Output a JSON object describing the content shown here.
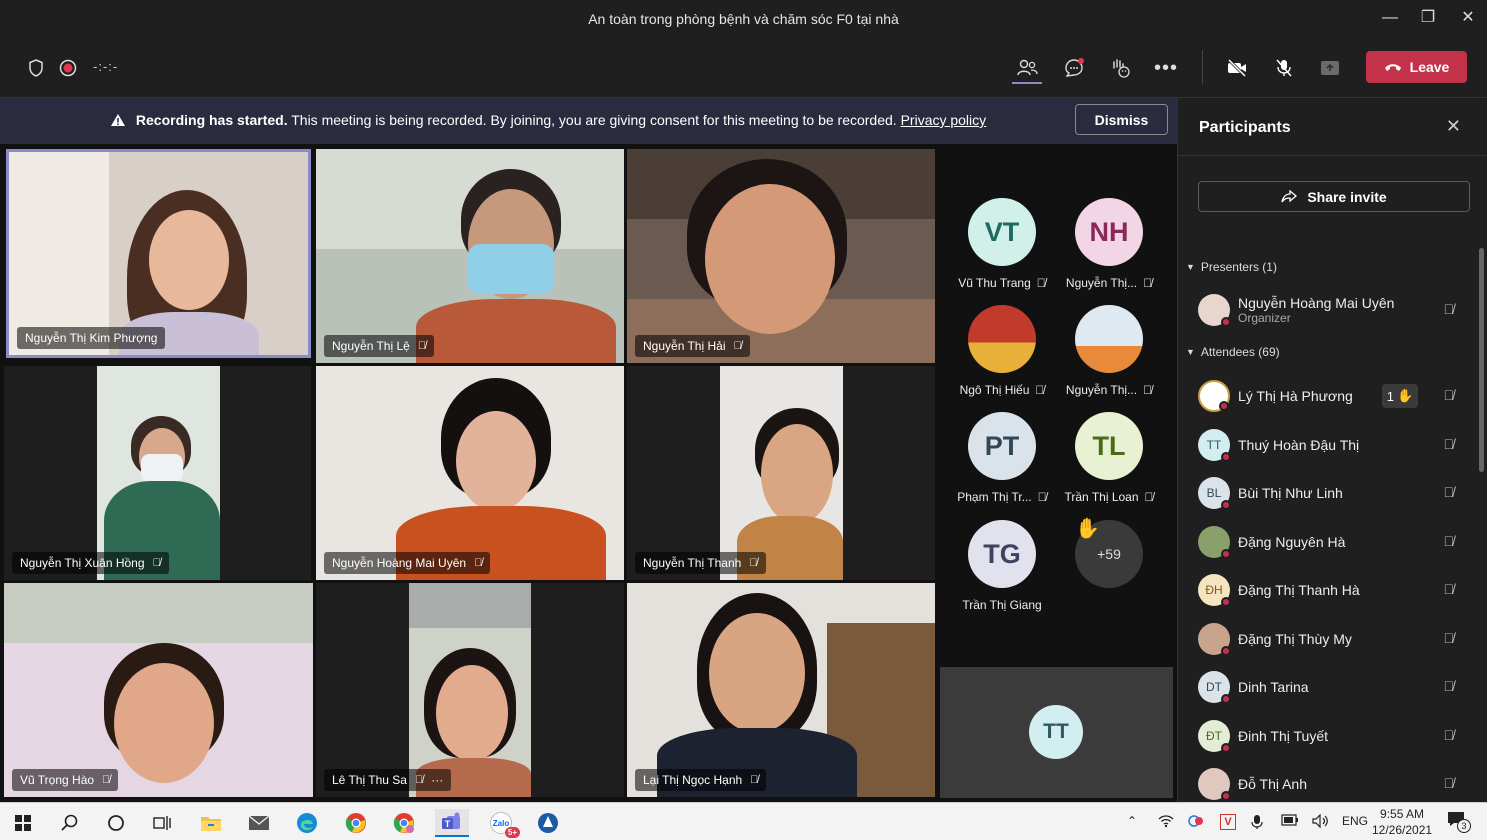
{
  "window": {
    "title": "An toàn trong phòng bệnh và chăm sóc F0 tại nhà",
    "controls": [
      "—",
      "❐",
      "✕"
    ]
  },
  "toolbar": {
    "timer": "-:-:-",
    "leave_label": "Leave",
    "icons": [
      "shield-icon",
      "record-icon",
      "people-icon",
      "chat-icon",
      "reactions-icon",
      "more-icon",
      "camera-off-icon",
      "mic-off-icon",
      "share-tray-icon"
    ]
  },
  "banner": {
    "bold": "Recording has started.",
    "text": " This meeting is being recorded. By joining, you are giving consent for this meeting to be recorded. ",
    "link": "Privacy policy",
    "dismiss_label": "Dismiss"
  },
  "video_tiles": [
    {
      "name": "Nguyễn Thị Kim Phượng",
      "muted": false
    },
    {
      "name": "Nguyễn Thị Lệ",
      "muted": true
    },
    {
      "name": "Nguyễn Thị Hải",
      "muted": true
    },
    {
      "name": "Nguyễn Thị Xuân Hồng",
      "muted": true
    },
    {
      "name": "Nguyễn Hoàng Mai Uyên",
      "muted": true
    },
    {
      "name": "Nguyễn Thị Thanh",
      "muted": true
    },
    {
      "name": "Vũ Trọng Hào",
      "muted": true
    },
    {
      "name": "Lê Thị Thu Sa",
      "muted": true
    },
    {
      "name": "Lại Thị Ngọc Hạnh",
      "muted": true
    }
  ],
  "avatar_grid": [
    {
      "initials": "VT",
      "label": "Vũ Thu Trang",
      "bg": "#d2f0ea",
      "fg": "#1d6b5e"
    },
    {
      "initials": "NH",
      "label": "Nguyễn Thị...",
      "bg": "#f3d6e6",
      "fg": "#8b2759"
    },
    {
      "initials": "",
      "label": "Ngô Thị Hiếu",
      "bg": "#b84b3a",
      "fg": "#fff"
    },
    {
      "initials": "",
      "label": "Nguyễn Thị...",
      "bg": "#e6eef5",
      "fg": "#333"
    },
    {
      "initials": "PT",
      "label": "Phạm Thị Tr...",
      "bg": "#dbe3ea",
      "fg": "#2f4858"
    },
    {
      "initials": "TL",
      "label": "Trần Thị Loan",
      "bg": "#e8f1d2",
      "fg": "#4c6b1a"
    },
    {
      "initials": "TG",
      "label": "Trần Thị Giang",
      "bg": "#e2e2ee",
      "fg": "#404060"
    }
  ],
  "more_count": "+59",
  "self_initials": "TT",
  "panel": {
    "title": "Participants",
    "share_invite": "Share invite",
    "presenters_label": "Presenters (1)",
    "attendees_label": "Attendees (69)",
    "presenter": {
      "name": "Nguyễn Hoàng Mai Uyên",
      "role": "Organizer"
    },
    "attendees": [
      {
        "initials": "",
        "name": "Lý Thị Hà Phương",
        "bg": "#fff",
        "hand": "1"
      },
      {
        "initials": "TT",
        "name": "Thuý Hoàn Đậu Thị",
        "bg": "#d2eef0"
      },
      {
        "initials": "BL",
        "name": "Bùi Thị Như Linh",
        "bg": "#dbe3ea"
      },
      {
        "initials": "",
        "name": "Đặng Nguyên Hà",
        "bg": "#8aa06a"
      },
      {
        "initials": "ĐH",
        "name": "Đặng Thị Thanh Hà",
        "bg": "#f5e4c0"
      },
      {
        "initials": "",
        "name": "Đặng Thị Thùy My",
        "bg": "#c9a48c"
      },
      {
        "initials": "DT",
        "name": "Dinh Tarina",
        "bg": "#dbe3ea"
      },
      {
        "initials": "ĐT",
        "name": "Đinh Thị Tuyết",
        "bg": "#e3ecd4"
      },
      {
        "initials": "",
        "name": "Đỗ Thị Anh",
        "bg": "#e0c8c0"
      }
    ]
  },
  "taskbar": {
    "lang": "ENG",
    "time": "9:55 AM",
    "date": "12/26/2021",
    "notif_count": "3",
    "zalo_badge": "5+"
  }
}
